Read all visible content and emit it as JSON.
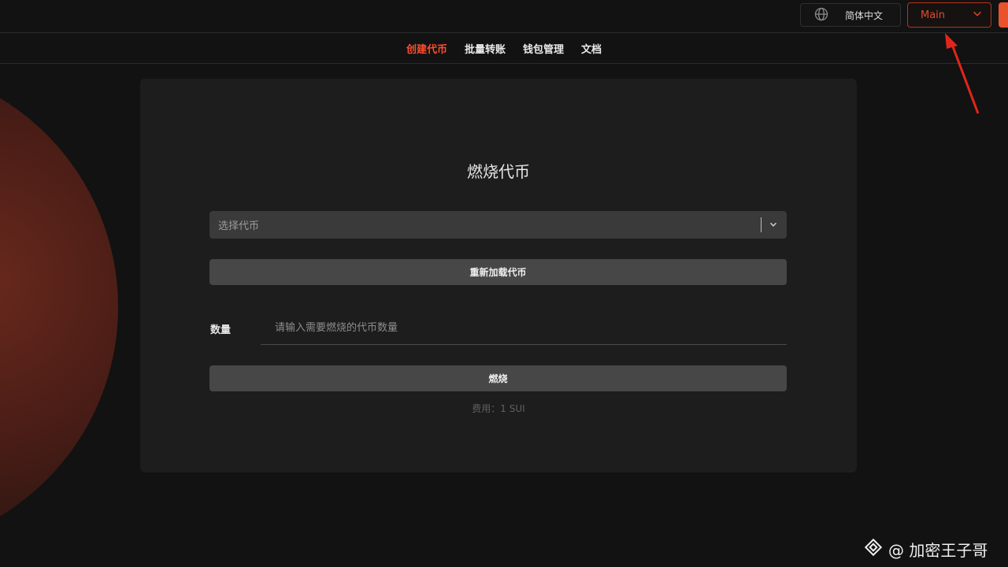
{
  "topbar": {
    "language_label": "简体中文",
    "network_label": "Main"
  },
  "nav": {
    "items": [
      {
        "label": "创建代币",
        "active": true
      },
      {
        "label": "批量转账",
        "active": false
      },
      {
        "label": "钱包管理",
        "active": false
      },
      {
        "label": "文档",
        "active": false
      }
    ]
  },
  "form": {
    "title": "燃烧代币",
    "token_select_placeholder": "选择代币",
    "reload_button_label": "重新加载代币",
    "amount_label": "数量",
    "amount_placeholder": "请输入需要燃烧的代币数量",
    "burn_button_label": "燃烧",
    "fee_text": "费用：1 SUI"
  },
  "watermark": {
    "text": "@ 加密王子哥"
  },
  "colors": {
    "accent": "#ff4d2e",
    "background": "#121212",
    "card": "#1d1d1d"
  },
  "icons": {
    "language": "globe-icon",
    "network_dropdown": "chevron-down-icon",
    "select_dropdown": "chevron-down-icon",
    "watermark": "diamond-logo-icon",
    "annotation": "red-arrow-icon"
  }
}
